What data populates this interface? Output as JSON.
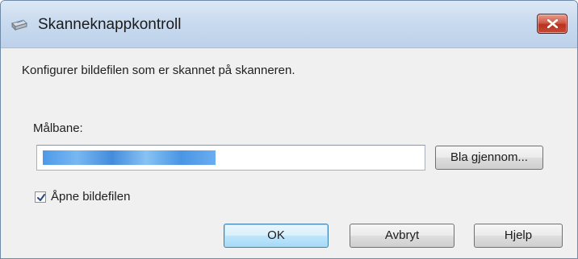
{
  "window": {
    "title": "Skanneknappkontroll",
    "icon": "scanner-icon",
    "close_icon": "close-icon",
    "close_color": "#c94b36"
  },
  "dialog": {
    "description": "Konfigurer bildefilen som er skannet på skanneren.",
    "path_label": "Målbane:",
    "path_value": "",
    "browse_label": "Bla gjennom...",
    "checkbox_label": "Åpne bildefilen",
    "checkbox_checked": true
  },
  "buttons": {
    "ok": "OK",
    "cancel": "Avbryt",
    "help": "Hjelp"
  }
}
